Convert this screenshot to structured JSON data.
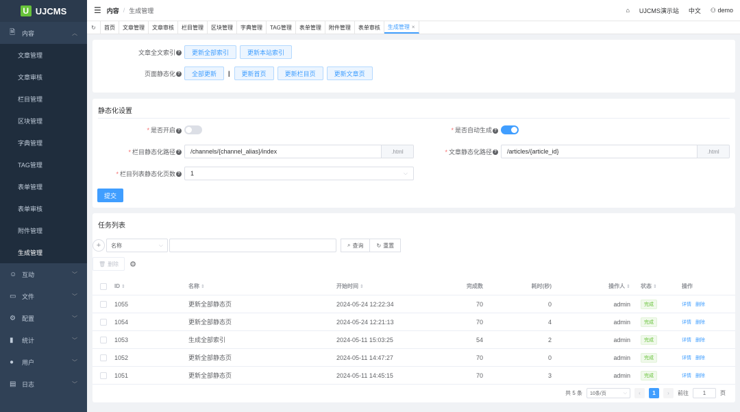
{
  "app": {
    "logo_text": "UJCMS",
    "logo_mark": "U"
  },
  "colors": {
    "primary": "#409eff",
    "sidebar_bg": "#304156",
    "success": "#67c23a"
  },
  "sidebar": {
    "groups": [
      {
        "label": "内容",
        "icon": "document-icon",
        "glyph": "🗎",
        "expanded": true,
        "items": [
          {
            "label": "文章管理"
          },
          {
            "label": "文章审核"
          },
          {
            "label": "栏目管理"
          },
          {
            "label": "区块管理"
          },
          {
            "label": "字典管理"
          },
          {
            "label": "TAG管理"
          },
          {
            "label": "表单管理"
          },
          {
            "label": "表单审核"
          },
          {
            "label": "附件管理"
          },
          {
            "label": "生成管理",
            "active": true
          }
        ]
      },
      {
        "label": "互动",
        "icon": "chat-icon",
        "glyph": "☺"
      },
      {
        "label": "文件",
        "icon": "folder-icon",
        "glyph": "▭"
      },
      {
        "label": "配置",
        "icon": "gear-icon",
        "glyph": "⚙"
      },
      {
        "label": "统计",
        "icon": "bar-chart-icon",
        "glyph": "▮"
      },
      {
        "label": "用户",
        "icon": "user-icon",
        "glyph": "●"
      },
      {
        "label": "日志",
        "icon": "log-icon",
        "glyph": "▤"
      }
    ]
  },
  "header": {
    "breadcrumb_root": "内容",
    "breadcrumb_current": "生成管理",
    "site_name": "UJCMS演示站",
    "language": "中文",
    "username": "demo"
  },
  "tabs": [
    {
      "label": "首页"
    },
    {
      "label": "文章管理"
    },
    {
      "label": "文章审核"
    },
    {
      "label": "栏目管理"
    },
    {
      "label": "区块管理"
    },
    {
      "label": "字典管理"
    },
    {
      "label": "TAG管理"
    },
    {
      "label": "表单管理"
    },
    {
      "label": "附件管理"
    },
    {
      "label": "表单审核"
    },
    {
      "label": "生成管理",
      "active": true
    }
  ],
  "generate": {
    "fulltext_label": "文章全文索引",
    "fulltext_buttons": [
      "更新全部索引",
      "更新本站索引"
    ],
    "static_label": "页面静态化",
    "static_all": "全部更新",
    "static_separator": "|",
    "static_buttons": [
      "更新首页",
      "更新栏目页",
      "更新文章页"
    ]
  },
  "static_settings": {
    "title": "静态化设置",
    "enable_label": "是否开启",
    "enable_value": false,
    "auto_label": "是否自动生成",
    "auto_value": true,
    "channel_path_label": "栏目静态化路径",
    "channel_path_value": "/channels/{channel_alias}/index",
    "channel_path_suffix": ".html",
    "article_path_label": "文章静态化路径",
    "article_path_value": "/articles/{article_id}",
    "article_path_suffix": ".html",
    "channel_pages_label": "栏目列表静态化页数",
    "channel_pages_value": "1",
    "submit_label": "提交"
  },
  "tasks": {
    "title": "任务列表",
    "search_field": "名称",
    "search_value": "",
    "query_label": "查询",
    "reset_label": "重置",
    "delete_label": "删除",
    "columns": {
      "id": "ID",
      "name": "名称",
      "start": "开始时间",
      "done": "完成数",
      "duration": "耗时(秒)",
      "operator": "操作人",
      "status": "状态",
      "actions": "操作"
    },
    "detail_label": "详情",
    "row_delete_label": "删除",
    "rows": [
      {
        "id": "1055",
        "name": "更新全部静态页",
        "start": "2024-05-24 12:22:34",
        "done": "70",
        "duration": "0",
        "operator": "admin",
        "status": "完成"
      },
      {
        "id": "1054",
        "name": "更新全部静态页",
        "start": "2024-05-24 12:21:13",
        "done": "70",
        "duration": "4",
        "operator": "admin",
        "status": "完成"
      },
      {
        "id": "1053",
        "name": "生成全部索引",
        "start": "2024-05-11 15:03:25",
        "done": "54",
        "duration": "2",
        "operator": "admin",
        "status": "完成"
      },
      {
        "id": "1052",
        "name": "更新全部静态页",
        "start": "2024-05-11 14:47:27",
        "done": "70",
        "duration": "0",
        "operator": "admin",
        "status": "完成"
      },
      {
        "id": "1051",
        "name": "更新全部静态页",
        "start": "2024-05-11 14:45:15",
        "done": "70",
        "duration": "3",
        "operator": "admin",
        "status": "完成"
      }
    ],
    "pagination": {
      "total_text": "共 5 条",
      "page_size": "10条/页",
      "current_page": "1",
      "goto_label": "前往",
      "goto_value": "1",
      "page_unit": "页"
    }
  }
}
